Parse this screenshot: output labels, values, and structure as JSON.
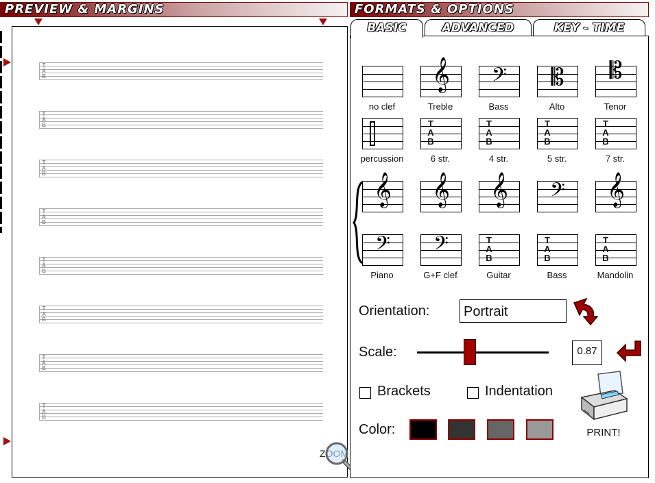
{
  "headers": {
    "preview": "PREVIEW & MARGINS",
    "formats": "FORMATS & OPTIONS"
  },
  "tabs": [
    {
      "label": "BASIC",
      "active": true
    },
    {
      "label": "ADVANCED",
      "active": false
    },
    {
      "label": "KEY - TIME",
      "active": false
    }
  ],
  "staff_tab_letters": [
    "T",
    "A",
    "B"
  ],
  "preview_staves": 8,
  "clef_row1": [
    "no clef",
    "Treble",
    "Bass",
    "Alto",
    "Tenor"
  ],
  "clef_row2": [
    "percussion",
    "6 str.",
    "4 str.",
    "5 str.",
    "7 str."
  ],
  "clef_row3": [
    "Piano",
    "G+F clef",
    "Guitar",
    "Bass",
    "Mandolin"
  ],
  "zoom_label": "ZOOM",
  "orientation": {
    "label": "Orientation:",
    "value": "Portrait"
  },
  "scale": {
    "label": "Scale:",
    "value": "0.87"
  },
  "brackets_label": "Brackets",
  "indentation_label": "Indentation",
  "color": {
    "label": "Color:",
    "swatches": [
      "#000000",
      "#333333",
      "#666666",
      "#999999"
    ]
  },
  "print_label": "PRINT!",
  "accent": "#a00000"
}
